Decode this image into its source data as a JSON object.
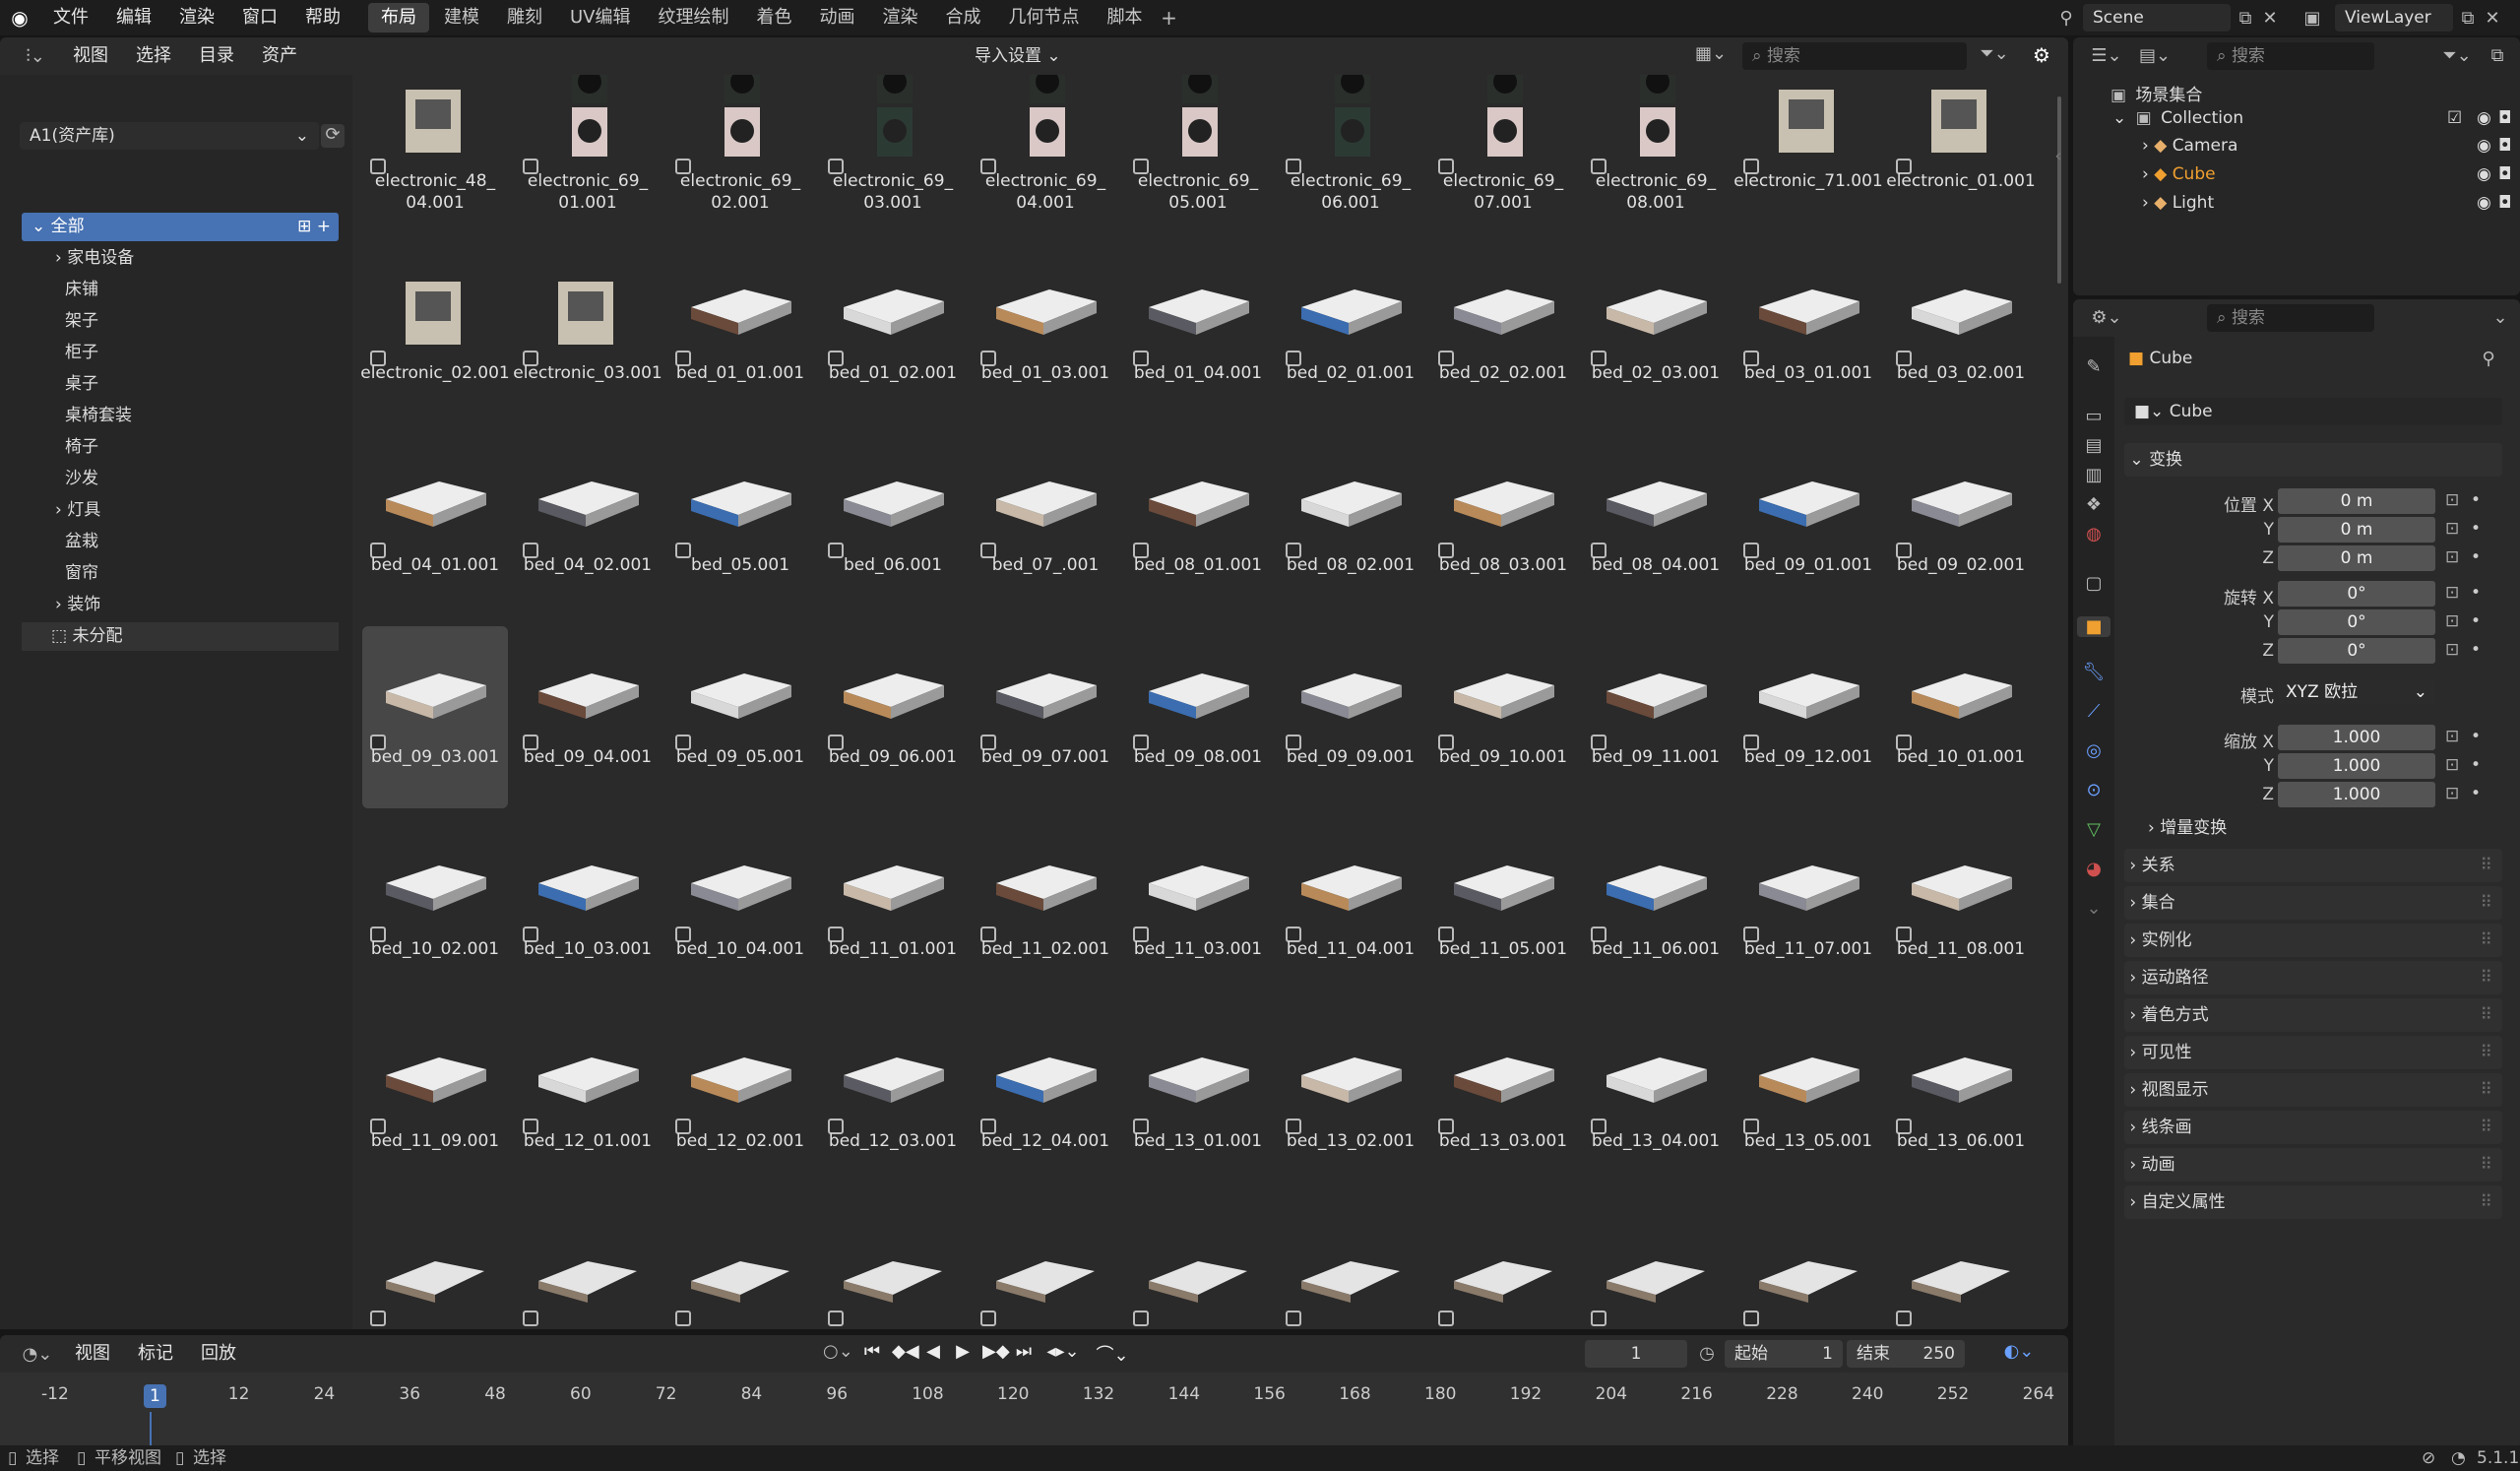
{
  "menus": [
    "文件",
    "编辑",
    "渲染",
    "窗口",
    "帮助"
  ],
  "workspaces": [
    "布局",
    "建模",
    "雕刻",
    "UV编辑",
    "纹理绘制",
    "着色",
    "动画",
    "渲染",
    "合成",
    "几何节点",
    "脚本"
  ],
  "active_workspace_index": 0,
  "scene": {
    "name": "Scene",
    "viewlayer": "ViewLayer"
  },
  "asset_browser": {
    "header_menus": [
      "视图",
      "选择",
      "目录",
      "资产"
    ],
    "import_settings": "导入设置",
    "search_placeholder": "搜索",
    "library": "A1(资产库)",
    "catalogs": [
      {
        "label": "全部",
        "indent": 0,
        "selected": true
      },
      {
        "label": "家电设备",
        "indent": 1,
        "expand": true
      },
      {
        "label": "床铺",
        "indent": 1
      },
      {
        "label": "架子",
        "indent": 1
      },
      {
        "label": "柜子",
        "indent": 1
      },
      {
        "label": "桌子",
        "indent": 1
      },
      {
        "label": "桌椅套装",
        "indent": 1
      },
      {
        "label": "椅子",
        "indent": 1
      },
      {
        "label": "沙发",
        "indent": 1
      },
      {
        "label": "灯具",
        "indent": 1,
        "expand": true
      },
      {
        "label": "盆栽",
        "indent": 1
      },
      {
        "label": "窗帘",
        "indent": 1
      },
      {
        "label": "装饰",
        "indent": 1,
        "expand": true
      },
      {
        "label": "未分配",
        "indent": 0,
        "unassigned": true
      }
    ],
    "assets": [
      [
        "electronic_48_\n04.001",
        "electronic_69_\n01.001",
        "electronic_69_\n02.001",
        "electronic_69_\n03.001",
        "electronic_69_\n04.001",
        "electronic_69_\n05.001",
        "electronic_69_\n06.001",
        "electronic_69_\n07.001",
        "electronic_69_\n08.001",
        "electronic_71.001",
        "electronic_01.001"
      ],
      [
        "electronic_02.001",
        "electronic_03.001",
        "bed_01_01.001",
        "bed_01_02.001",
        "bed_01_03.001",
        "bed_01_04.001",
        "bed_02_01.001",
        "bed_02_02.001",
        "bed_02_03.001",
        "bed_03_01.001",
        "bed_03_02.001"
      ],
      [
        "bed_04_01.001",
        "bed_04_02.001",
        "bed_05.001",
        "bed_06.001",
        "bed_07_.001",
        "bed_08_01.001",
        "bed_08_02.001",
        "bed_08_03.001",
        "bed_08_04.001",
        "bed_09_01.001",
        "bed_09_02.001"
      ],
      [
        "bed_09_03.001",
        "bed_09_04.001",
        "bed_09_05.001",
        "bed_09_06.001",
        "bed_09_07.001",
        "bed_09_08.001",
        "bed_09_09.001",
        "bed_09_10.001",
        "bed_09_11.001",
        "bed_09_12.001",
        "bed_10_01.001"
      ],
      [
        "bed_10_02.001",
        "bed_10_03.001",
        "bed_10_04.001",
        "bed_11_01.001",
        "bed_11_02.001",
        "bed_11_03.001",
        "bed_11_04.001",
        "bed_11_05.001",
        "bed_11_06.001",
        "bed_11_07.001",
        "bed_11_08.001"
      ],
      [
        "bed_11_09.001",
        "bed_12_01.001",
        "bed_12_02.001",
        "bed_12_03.001",
        "bed_12_04.001",
        "bed_13_01.001",
        "bed_13_02.001",
        "bed_13_03.001",
        "bed_13_04.001",
        "bed_13_05.001",
        "bed_13_06.001"
      ],
      [
        "",
        "",
        "",
        "",
        "",
        "",
        "",
        "",
        "",
        "",
        ""
      ]
    ],
    "selected_asset": "bed_09_03.001"
  },
  "timeline": {
    "menus": [
      "视图",
      "标记",
      "回放"
    ],
    "current_frame": "1",
    "start_label": "起始",
    "start": "1",
    "end_label": "结束",
    "end": "250",
    "ticks": [
      "-12",
      "1",
      "12",
      "24",
      "36",
      "48",
      "60",
      "72",
      "84",
      "96",
      "108",
      "120",
      "132",
      "144",
      "156",
      "168",
      "180",
      "192",
      "204",
      "216",
      "228",
      "240",
      "252",
      "264"
    ]
  },
  "outliner": {
    "search_placeholder": "搜索",
    "root": "场景集合",
    "collection": "Collection",
    "items": [
      {
        "label": "Camera",
        "color": "#e8b06a",
        "icon": "camera-icon"
      },
      {
        "label": "Cube",
        "color": "#f0a030",
        "icon": "mesh-icon"
      },
      {
        "label": "Light",
        "color": "#e8b06a",
        "icon": "light-icon"
      }
    ]
  },
  "properties": {
    "search_placeholder": "搜索",
    "object_name": "Cube",
    "data_name": "Cube",
    "transform_label": "变换",
    "location_label": "位置 X",
    "rotation_label": "旋转 X",
    "scale_label": "缩放 X",
    "location": [
      "0 m",
      "0 m",
      "0 m"
    ],
    "rotation": [
      "0°",
      "0°",
      "0°"
    ],
    "mode_label": "模式",
    "mode": "XYZ 欧拉",
    "scale": [
      "1.000",
      "1.000",
      "1.000"
    ],
    "delta_label": "增量变换",
    "sections": [
      "关系",
      "集合",
      "实例化",
      "运动路径",
      "着色方式",
      "可见性",
      "视图显示",
      "线条画",
      "动画",
      "自定义属性"
    ]
  },
  "status": {
    "items": [
      "选择",
      "平移视图",
      "选择"
    ],
    "version": "5.1.1"
  }
}
